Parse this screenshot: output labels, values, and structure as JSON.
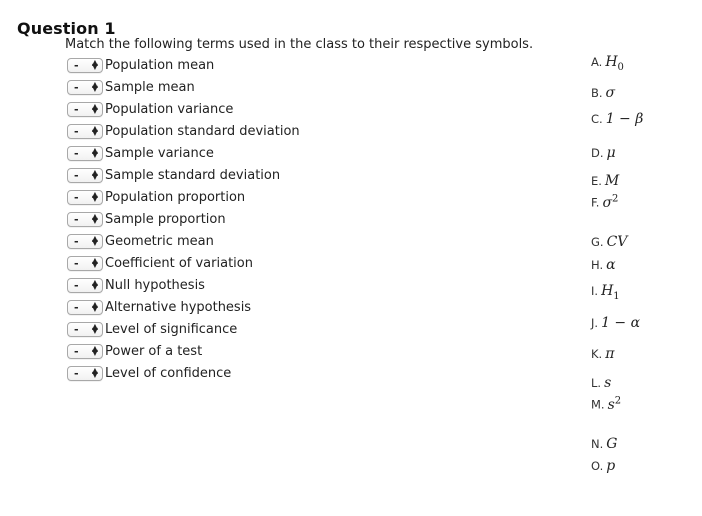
{
  "question": {
    "title": "Question 1",
    "prompt": "Match the following terms used in the class to their respective symbols."
  },
  "select_default": "-",
  "terms": [
    "Population mean",
    "Sample mean",
    "Population variance",
    "Population standard deviation",
    "Sample variance",
    "Sample standard deviation",
    "Population proportion",
    "Sample proportion",
    "Geometric mean",
    "Coefficient of variation",
    "Null hypothesis",
    "Alternative hypothesis",
    "Level of significance",
    "Power of a test",
    "Level of confidence"
  ],
  "choices": [
    {
      "letter": "A.",
      "base": "H",
      "sub": "0",
      "sup": ""
    },
    {
      "letter": "B.",
      "base": "σ",
      "sub": "",
      "sup": ""
    },
    {
      "letter": "C.",
      "base": "1 − β",
      "sub": "",
      "sup": ""
    },
    {
      "letter": "D.",
      "base": "μ",
      "sub": "",
      "sup": ""
    },
    {
      "letter": "E.",
      "base": "M",
      "sub": "",
      "sup": ""
    },
    {
      "letter": "F.",
      "base": "σ",
      "sub": "",
      "sup": "2"
    },
    {
      "letter": "G.",
      "base": "CV",
      "sub": "",
      "sup": ""
    },
    {
      "letter": "H.",
      "base": "α",
      "sub": "",
      "sup": ""
    },
    {
      "letter": "I.",
      "base": "H",
      "sub": "1",
      "sup": ""
    },
    {
      "letter": "J.",
      "base": "1 − α",
      "sub": "",
      "sup": ""
    },
    {
      "letter": "K.",
      "base": "π",
      "sub": "",
      "sup": ""
    },
    {
      "letter": "L.",
      "base": "s",
      "sub": "",
      "sup": ""
    },
    {
      "letter": "M.",
      "base": "s",
      "sub": "",
      "sup": "2"
    },
    {
      "letter": "N.",
      "base": "G",
      "sub": "",
      "sup": ""
    },
    {
      "letter": "O.",
      "base": "p",
      "sub": "",
      "sup": ""
    }
  ]
}
